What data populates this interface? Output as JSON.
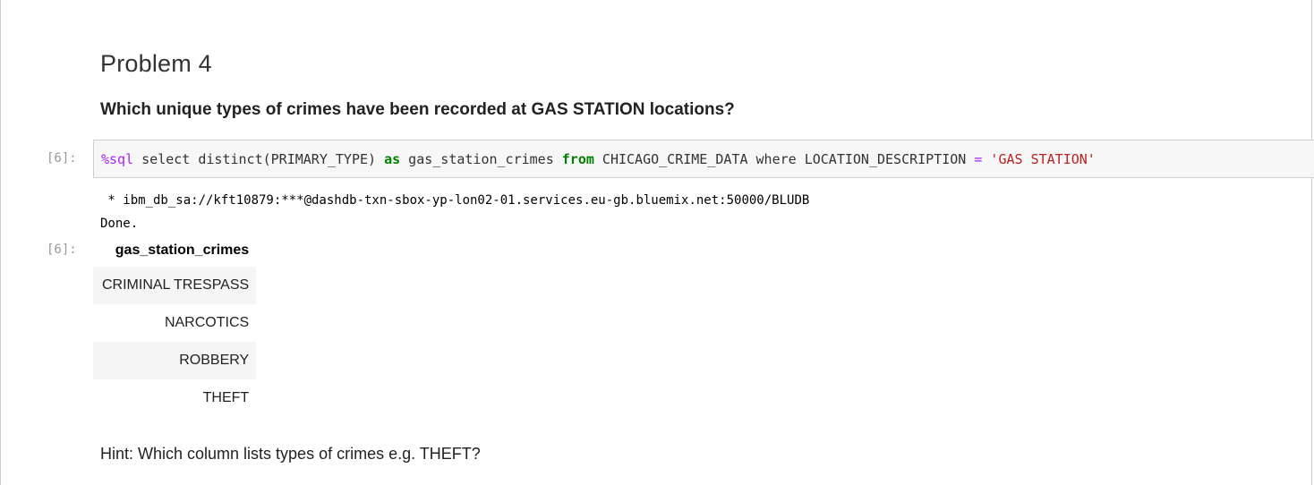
{
  "markdown": {
    "title": "Problem 4",
    "question": "Which unique types of crimes have been recorded at GAS STATION locations?",
    "hint": "Hint: Which column lists types of crimes e.g. THEFT?"
  },
  "cell": {
    "in_prompt": "[6]:",
    "out_prompt": "[6]:",
    "code": {
      "magic": "%sql",
      "p1": " select distinct(PRIMARY_TYPE) ",
      "kw_as": "as",
      "p2": " gas_station_crimes ",
      "kw_from": "from",
      "p3": " CHICAGO_CRIME_DATA where LOCATION_DESCRIPTION ",
      "op_eq": "=",
      "p4": " ",
      "str": "'GAS STATION'"
    },
    "stdout": {
      "line1": " * ibm_db_sa://kft10879:***@dashdb-txn-sbox-yp-lon02-01.services.eu-gb.bluemix.net:50000/BLUDB",
      "line2": "Done."
    },
    "result": {
      "header": "gas_station_crimes",
      "rows": [
        "CRIMINAL TRESPASS",
        "NARCOTICS",
        "ROBBERY",
        "THEFT"
      ]
    }
  }
}
